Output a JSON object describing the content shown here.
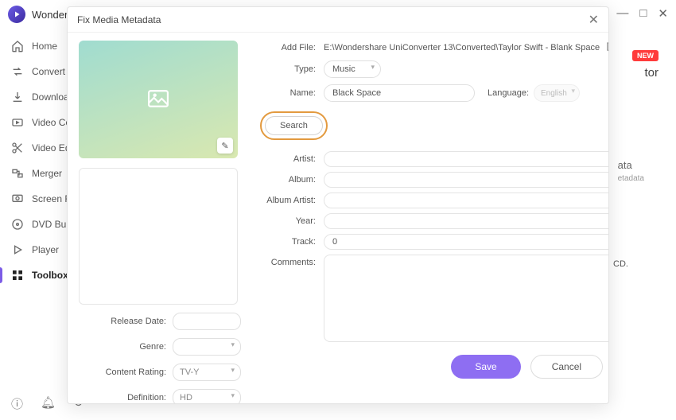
{
  "app": {
    "title": "Wonder"
  },
  "window_controls": {
    "min": "—",
    "max": "□",
    "close": "✕"
  },
  "sidebar": {
    "items": [
      {
        "label": "Home"
      },
      {
        "label": "Convert"
      },
      {
        "label": "Downloa"
      },
      {
        "label": "Video Co"
      },
      {
        "label": "Video Ed"
      },
      {
        "label": "Merger"
      },
      {
        "label": "Screen R"
      },
      {
        "label": "DVD Bu"
      },
      {
        "label": "Player"
      },
      {
        "label": "Toolbox"
      }
    ]
  },
  "bg": {
    "new_badge": "NEW",
    "tor": "tor",
    "ata": "ata",
    "etadata": "etadata",
    "cd": "CD."
  },
  "modal": {
    "title": "Fix Media Metadata",
    "close": "✕",
    "art_edit_icon": "✎",
    "left": {
      "release_date": {
        "label": "Release Date:",
        "value": ""
      },
      "genre": {
        "label": "Genre:",
        "value": ""
      },
      "content_rating": {
        "label": "Content Rating:",
        "value": "TV-Y"
      },
      "definition": {
        "label": "Definition:",
        "value": "HD"
      }
    },
    "right": {
      "add_file": {
        "label": "Add File:",
        "path": "E:\\Wondershare UniConverter 13\\Converted\\Taylor Swift - Blank Space"
      },
      "type": {
        "label": "Type:",
        "value": "Music"
      },
      "name": {
        "label": "Name:",
        "value": "Black Space"
      },
      "language": {
        "label": "Language:",
        "value": "English"
      },
      "search_btn": "Search",
      "artist": {
        "label": "Artist:",
        "value": ""
      },
      "album": {
        "label": "Album:",
        "value": ""
      },
      "album_artist": {
        "label": "Album Artist:",
        "value": ""
      },
      "year": {
        "label": "Year:",
        "value": ""
      },
      "track": {
        "label": "Track:",
        "value": "0"
      },
      "comments": {
        "label": "Comments:",
        "value": ""
      }
    },
    "footer": {
      "save": "Save",
      "cancel": "Cancel"
    }
  }
}
